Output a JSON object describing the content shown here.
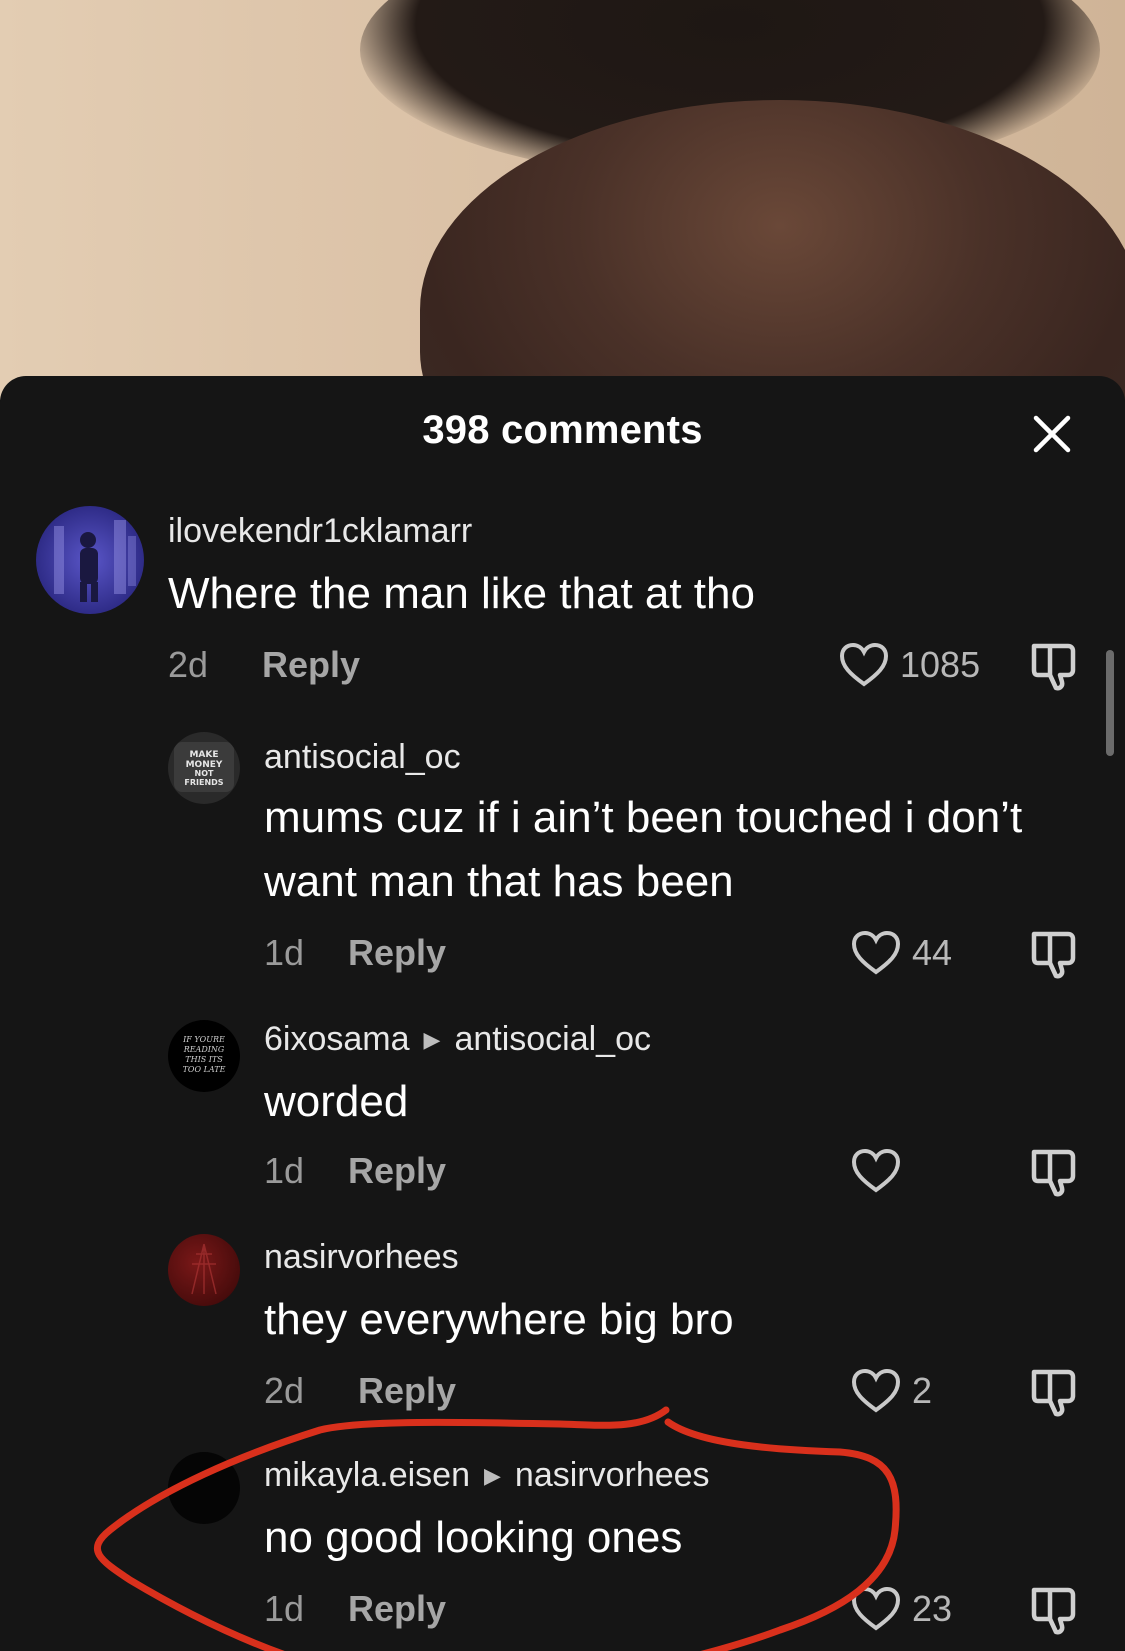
{
  "sheet": {
    "title": "398 comments",
    "close_icon": "close-icon"
  },
  "comments": [
    {
      "username": "ilovekendr1cklamarr",
      "text": "Where the man like that at tho",
      "age": "2d",
      "reply_label": "Reply",
      "likes": "1085",
      "avatar_color": "#3d3aa0"
    },
    {
      "username": "antisocial_oc",
      "text_line1": "mums cuz if i ain’t been touched i don’t",
      "text_line2": "want man that has been",
      "age": "1d",
      "reply_label": "Reply",
      "likes": "44",
      "avatar_lines": [
        "MAKE",
        "MONEY",
        "NOT",
        "FRIENDS"
      ]
    },
    {
      "username": "6ixosama",
      "reply_to": "antisocial_oc",
      "text": "worded",
      "age": "1d",
      "reply_label": "Reply",
      "likes": "",
      "avatar_lines": [
        "IF YOURE",
        "READING",
        "THIS ITS",
        "TOO LATE"
      ]
    },
    {
      "username": "nasirvorhees",
      "text": "they everywhere big bro",
      "age": "2d",
      "reply_label": "Reply",
      "likes": "2",
      "avatar_color": "#5a1010"
    },
    {
      "username": "mikayla.eisen",
      "reply_to": "nasirvorhees",
      "text": "no good looking ones",
      "age": "1d",
      "reply_label": "Reply",
      "likes": "23",
      "avatar_color": "#050505"
    }
  ],
  "colors": {
    "sheet_bg": "#151515",
    "annotation_stroke": "#d9301c"
  }
}
